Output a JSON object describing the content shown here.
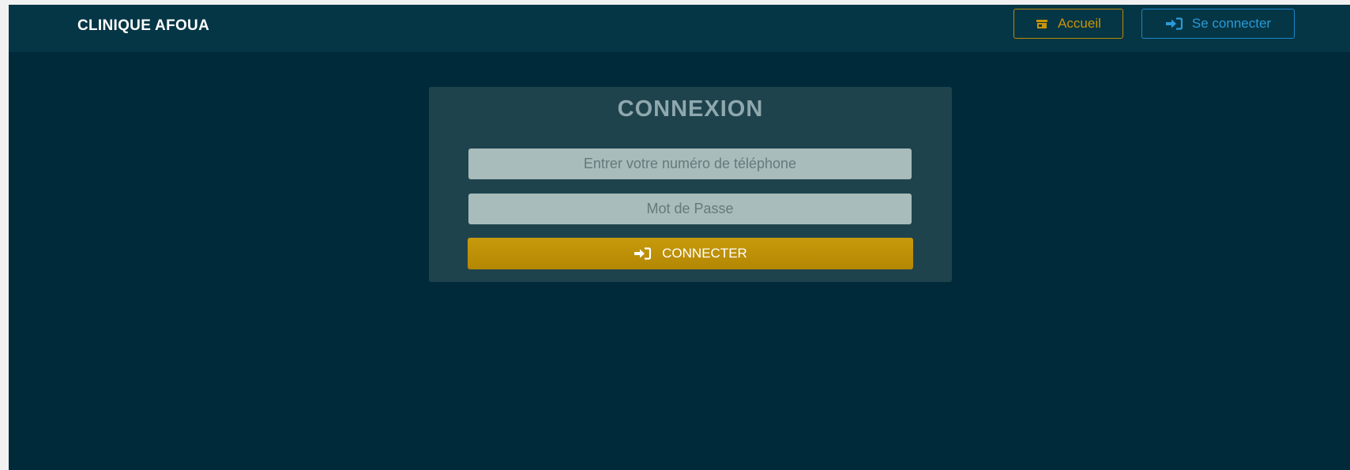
{
  "header": {
    "brand": "CLINIQUE AFOUA",
    "accueil_label": "Accueil",
    "accueil_icon": "store-icon",
    "login_label": "Se connecter",
    "login_icon": "sign-in-icon"
  },
  "login_card": {
    "title": "CONNEXION",
    "phone_placeholder": "Entrer votre numéro de téléphone",
    "phone_value": "",
    "password_placeholder": "Mot de Passe",
    "password_value": "",
    "submit_label": "CONNECTER",
    "submit_icon": "sign-in-icon"
  },
  "colors": {
    "background": "#00293a",
    "navbar": "#053645",
    "card": "#1f434d",
    "accent_gold": "#c99406",
    "accent_blue": "#2a9ad8",
    "input_bg": "#a8bcbb"
  }
}
